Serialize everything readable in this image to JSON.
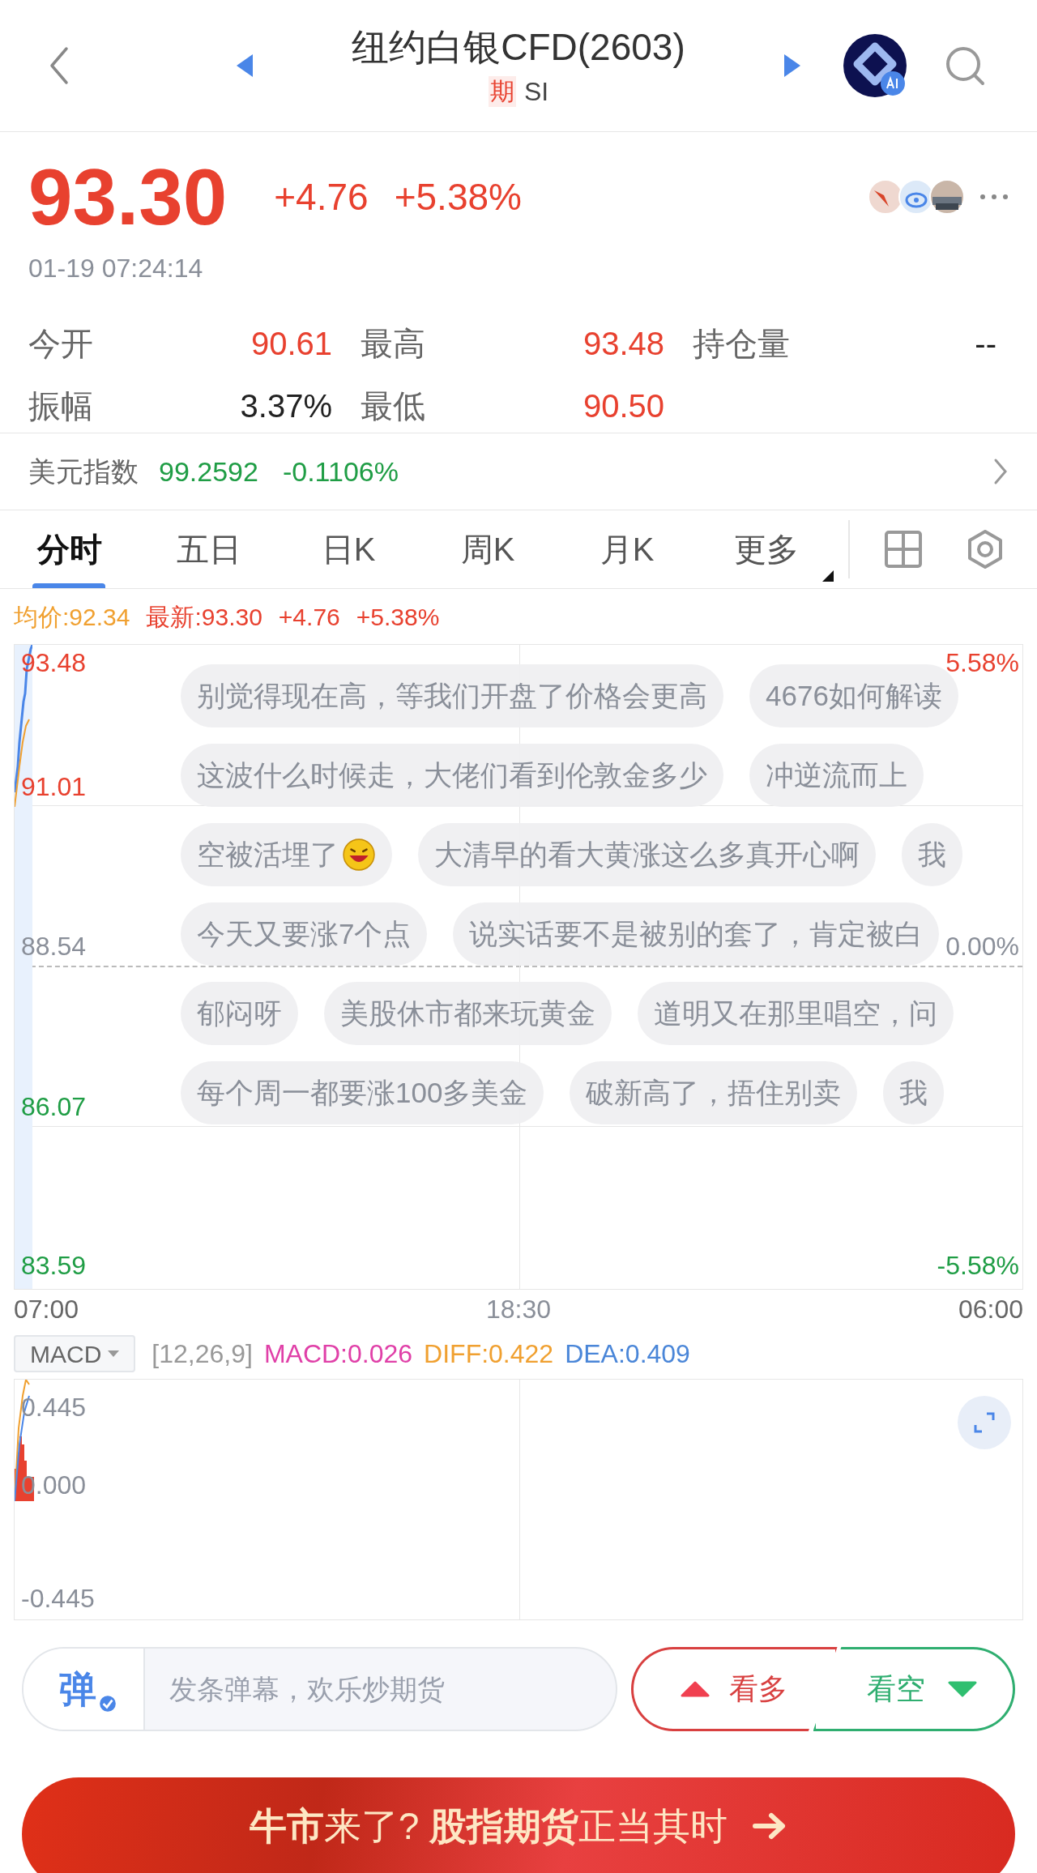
{
  "header": {
    "title": "纽约白银CFD(2603)",
    "market_tag": "期",
    "symbol": "SI"
  },
  "quote": {
    "price": "93.30",
    "change": "+4.76",
    "change_pct": "+5.38%",
    "time": "01-19 07:24:14"
  },
  "stats": [
    {
      "label": "今开",
      "value": "90.61",
      "color": "#e8412f"
    },
    {
      "label": "最高",
      "value": "93.48",
      "color": "#e8412f"
    },
    {
      "label": "持仓量",
      "value": "--",
      "color": "#222222"
    },
    {
      "label": "振幅",
      "value": "3.37%",
      "color": "#222222"
    },
    {
      "label": "最低",
      "value": "90.50",
      "color": "#e8412f"
    }
  ],
  "index_bar": {
    "label": "美元指数",
    "value": "99.2592",
    "change": "-0.1106%"
  },
  "tabs": [
    {
      "label": "分时",
      "selected": true,
      "kind": "tab"
    },
    {
      "label": "五日",
      "selected": false,
      "kind": "tab"
    },
    {
      "label": "日K",
      "selected": false,
      "kind": "tab"
    },
    {
      "label": "周K",
      "selected": false,
      "kind": "tab"
    },
    {
      "label": "月K",
      "selected": false,
      "kind": "tab"
    },
    {
      "label": "更多",
      "selected": false,
      "kind": "menu"
    }
  ],
  "chart": {
    "legend": [
      {
        "text": "均价:92.34",
        "kind": "avg"
      },
      {
        "text": "最新:93.30",
        "kind": "last"
      },
      {
        "text": "+4.76",
        "kind": "last"
      },
      {
        "text": "+5.38%",
        "kind": "last"
      }
    ],
    "left_axis": [
      {
        "text": "93.48",
        "color": "#e8412f"
      },
      {
        "text": "91.01",
        "color": "#e8412f"
      },
      {
        "text": "88.54",
        "color": "#8a8f99"
      },
      {
        "text": "86.07",
        "color": "#1f9d45"
      },
      {
        "text": "83.59",
        "color": "#1f9d45"
      }
    ],
    "right_axis": [
      {
        "text": "5.58%",
        "color": "#e8412f"
      },
      {
        "text": "0.00%",
        "color": "#8a8f99"
      },
      {
        "text": "-5.58%",
        "color": "#1f9d45"
      }
    ],
    "x_axis": [
      "07:00",
      "18:30",
      "06:00"
    ]
  },
  "danmaku": [
    [
      {
        "text": "别觉得现在高，等我们开盘了价格会更高",
        "emoji": false
      },
      {
        "text": "4676如何解读",
        "emoji": false
      }
    ],
    [
      {
        "text": "这波什么时候走，大佬们看到伦敦金多少",
        "emoji": false
      },
      {
        "text": "冲逆流而上",
        "emoji": false
      }
    ],
    [
      {
        "text": "空被活埋了",
        "emoji": true
      },
      {
        "text": "大清早的看大黄涨这么多真开心啊",
        "emoji": false
      },
      {
        "text": "我",
        "emoji": false
      }
    ],
    [
      {
        "text": "今天又要涨7个点",
        "emoji": false
      },
      {
        "text": "说实话要不是被别的套了，肯定被白",
        "emoji": false
      }
    ],
    [
      {
        "text": "郁闷呀",
        "emoji": false
      },
      {
        "text": "美股休市都来玩黄金",
        "emoji": false
      },
      {
        "text": "道明又在那里唱空，问",
        "emoji": false
      }
    ],
    [
      {
        "text": "每个周一都要涨100多美金",
        "emoji": false
      },
      {
        "text": "破新高了，捂住别卖",
        "emoji": false
      },
      {
        "text": "我",
        "emoji": false
      }
    ]
  ],
  "macd": {
    "indicator": "MACD",
    "params": "[12,26,9]",
    "values": [
      {
        "text": "MACD:0.026",
        "color": "#e040a8"
      },
      {
        "text": "DIFF:0.422",
        "color": "#f0a030"
      },
      {
        "text": "DEA:0.409",
        "color": "#4a86d8"
      }
    ],
    "axis": [
      "0.445",
      "0.000",
      "-0.445"
    ]
  },
  "composer": {
    "badge": "弹",
    "placeholder": "发条弹幕，欢乐炒期货",
    "bullish": "看多",
    "bearish": "看空"
  },
  "banner": {
    "text": "**牛市**来了? **股指期货**正当其时"
  }
}
